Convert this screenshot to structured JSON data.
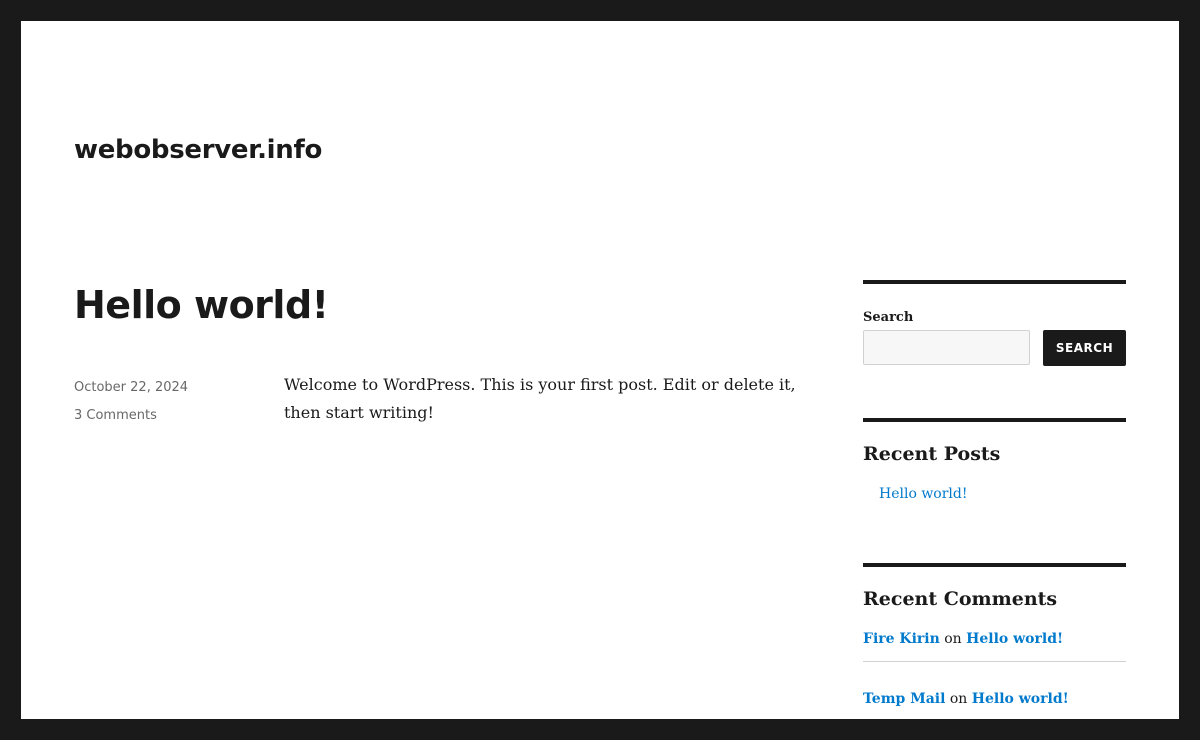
{
  "site": {
    "title": "webobserver.info"
  },
  "post": {
    "title": "Hello world!",
    "date": "October 22, 2024",
    "comments": "3 Comments",
    "content": "Welcome to WordPress. This is your first post. Edit or delete it, then start writing!"
  },
  "sidebar": {
    "search": {
      "label": "Search",
      "value": "",
      "button": "SEARCH"
    },
    "recent_posts": {
      "title": "Recent Posts",
      "items": [
        "Hello world!"
      ]
    },
    "recent_comments": {
      "title": "Recent Comments",
      "items": [
        {
          "author": "Fire Kirin",
          "on": "on",
          "post": "Hello world!"
        },
        {
          "author": "Temp Mail",
          "on": "on",
          "post": "Hello world!"
        }
      ]
    }
  },
  "colors": {
    "frame": "#1a1a1a",
    "background": "#ffffff",
    "text": "#1a1a1a",
    "link": "#007acc",
    "meta": "#686868"
  }
}
